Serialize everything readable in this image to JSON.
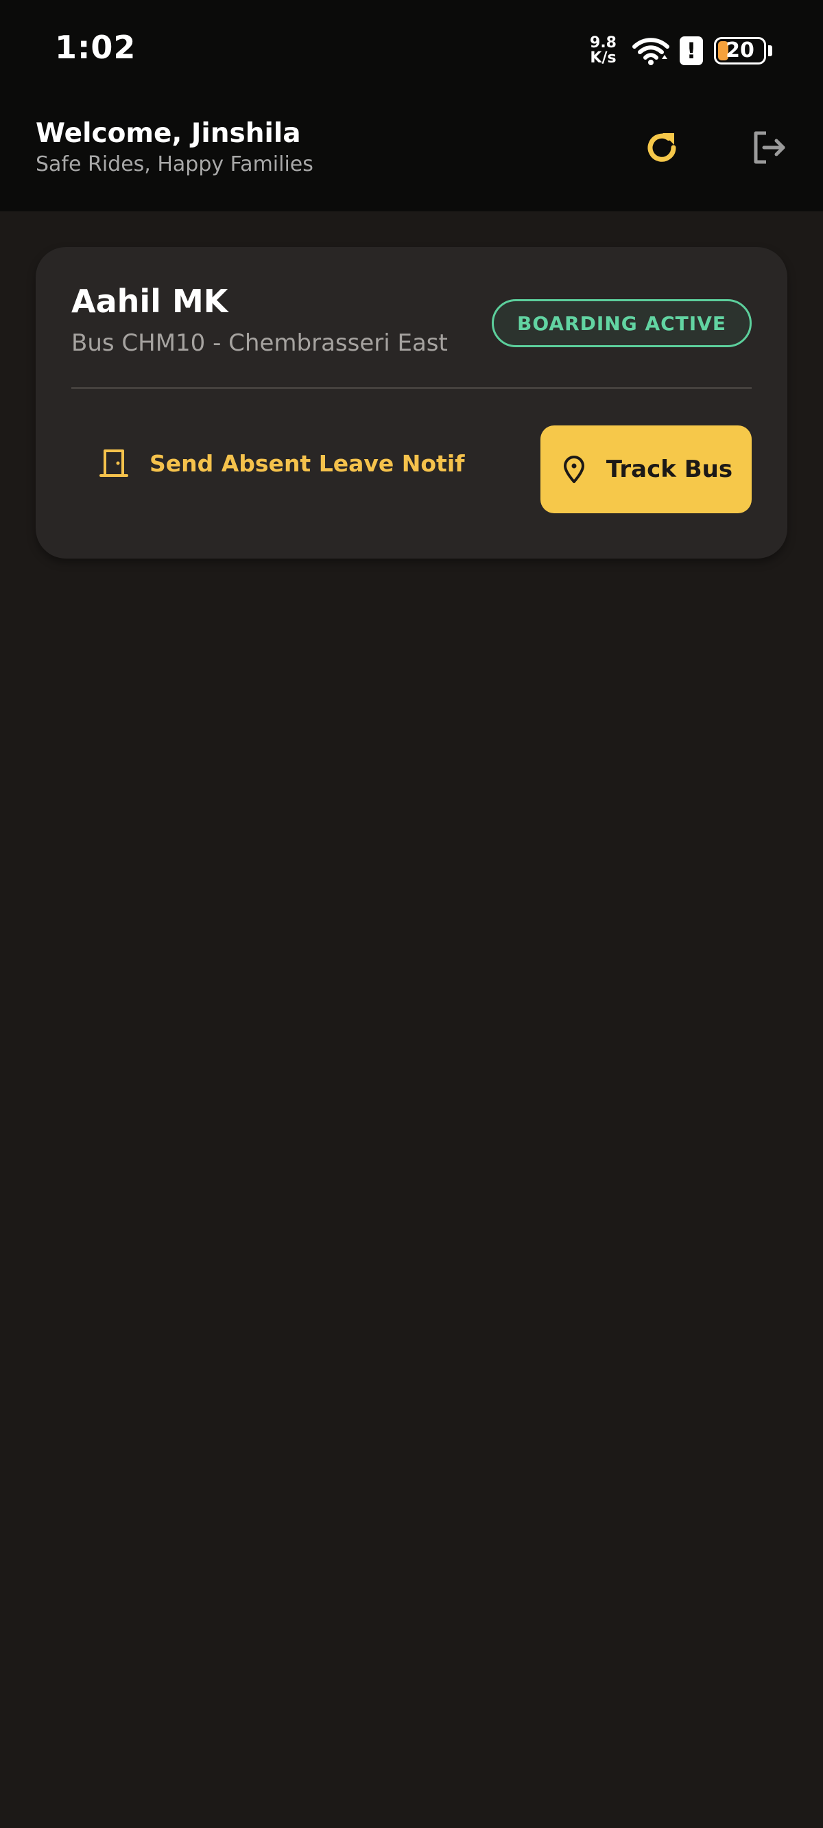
{
  "status_bar": {
    "time": "1:02",
    "net_speed_value": "9.8",
    "net_speed_unit": "K/s",
    "alert_symbol": "!",
    "battery_level": "20",
    "icons": [
      "wifi-icon",
      "alert-icon",
      "battery-icon"
    ]
  },
  "header": {
    "welcome": "Welcome, Jinshila",
    "tagline": "Safe Rides, Happy Families",
    "refresh_icon": "refresh-icon",
    "logout_icon": "logout-icon"
  },
  "student_card": {
    "name": "Aahil MK",
    "route": "Bus CHM10 - Chembrasseri East",
    "status": "BOARDING ACTIVE",
    "absent_button_label": "Send Absent Leave Notif",
    "absent_icon": "door-icon",
    "track_button_label": "Track Bus",
    "track_icon": "location-pin-icon"
  },
  "colors": {
    "background": "#1c1917",
    "top_bar": "#0b0b0a",
    "card": "#292625",
    "accent_yellow": "#f6c84a",
    "status_green": "#5ccf9c",
    "muted_text": "#a8a8a8"
  }
}
